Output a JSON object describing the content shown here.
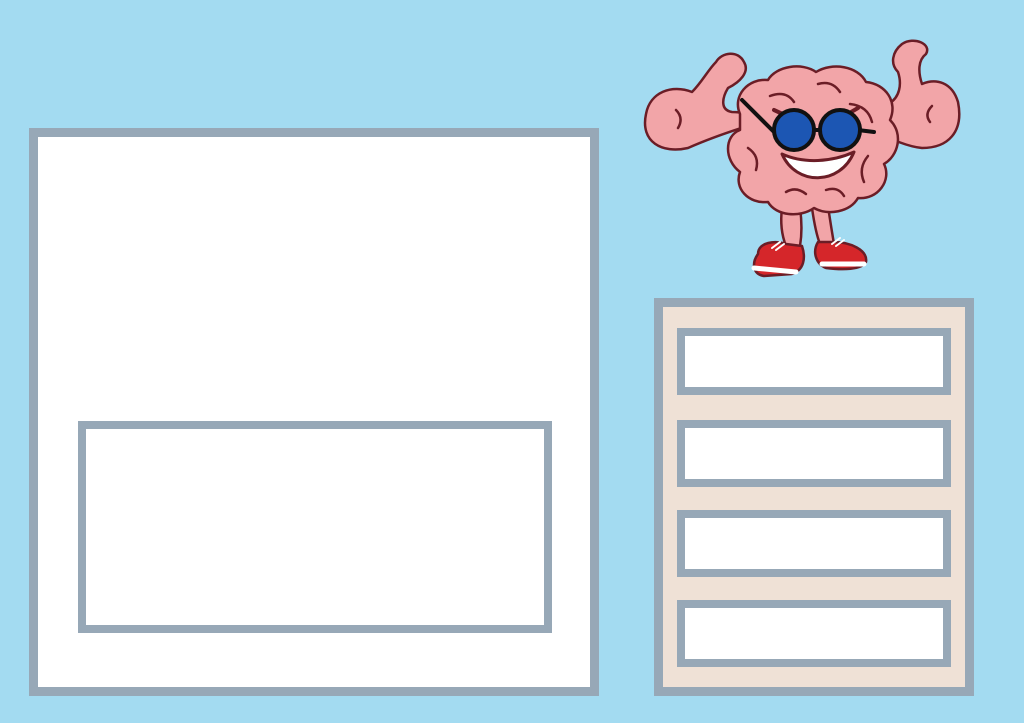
{
  "worksheet": {
    "mascot": {
      "icon": "strong-brain-icon",
      "colors": {
        "brain": "#f2a5a8",
        "outline": "#6b1d26",
        "glasses": "#1c56b3",
        "shoes": "#d5262a"
      }
    },
    "main_panel": {
      "text": ""
    },
    "answer_box": {
      "text": ""
    },
    "options": [
      {
        "text": ""
      },
      {
        "text": ""
      },
      {
        "text": ""
      },
      {
        "text": ""
      }
    ],
    "colors": {
      "background": "#a3dbf1",
      "frame": "#97a8b7",
      "options_panel": "#efe1d6"
    }
  }
}
